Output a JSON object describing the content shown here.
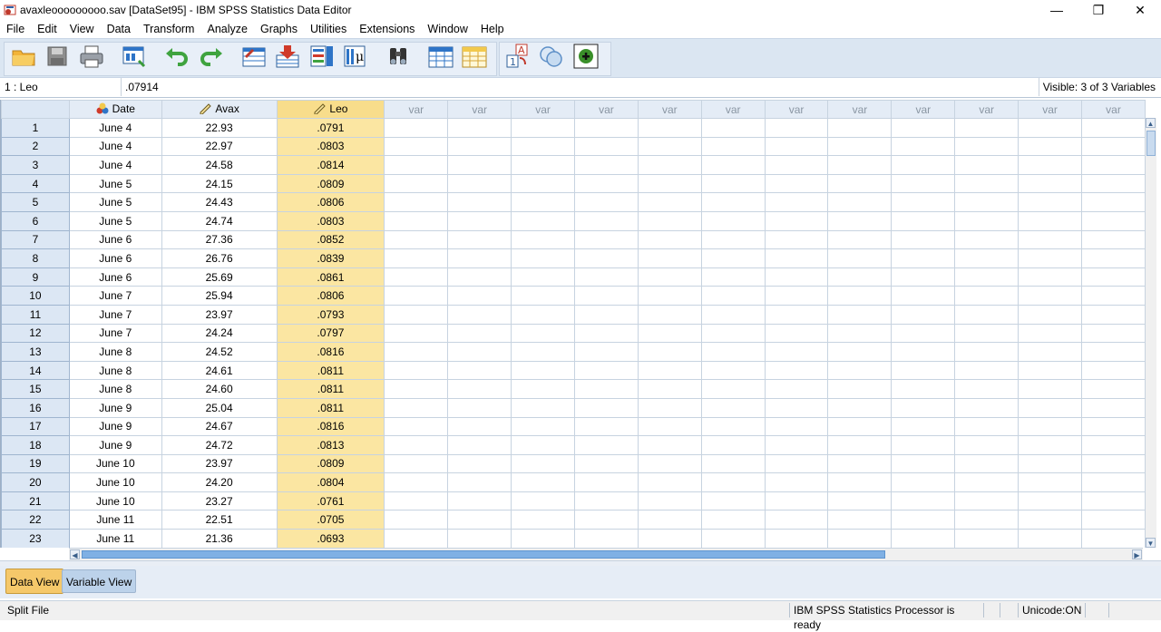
{
  "window": {
    "title": "avaxleooooooooo.sav [DataSet95] - IBM SPSS Statistics Data Editor",
    "minimize": "—",
    "restore": "❐",
    "close": "✕"
  },
  "menu": [
    "File",
    "Edit",
    "View",
    "Data",
    "Transform",
    "Analyze",
    "Graphs",
    "Utilities",
    "Extensions",
    "Window",
    "Help"
  ],
  "toolbar_icons": [
    "open-folder-icon",
    "save-icon",
    "print-icon",
    "recall-dialog-icon",
    "undo-icon",
    "redo-icon",
    "goto-case-icon",
    "goto-variable-icon",
    "variables-icon",
    "run-descriptives-icon",
    "find-icon",
    "insert-cases-icon",
    "insert-variable-icon",
    "value-labels-icon",
    "use-sets-icon",
    "show-all-icon"
  ],
  "cellbar": {
    "ref": "1 : Leo",
    "value": ".07914",
    "visible": "Visible: 3 of 3 Variables"
  },
  "grid": {
    "columns": [
      {
        "name": "Date",
        "icon": "nominal-icon"
      },
      {
        "name": "Avax",
        "icon": "scale-icon"
      },
      {
        "name": "Leo",
        "icon": "scale-icon"
      }
    ],
    "empty_column_label": "var",
    "rows": [
      [
        "1",
        "June 4",
        "22.93",
        ".0791"
      ],
      [
        "2",
        "June 4",
        "22.97",
        ".0803"
      ],
      [
        "3",
        "June 4",
        "24.58",
        ".0814"
      ],
      [
        "4",
        "June 5",
        "24.15",
        ".0809"
      ],
      [
        "5",
        "June 5",
        "24.43",
        ".0806"
      ],
      [
        "6",
        "June 5",
        "24.74",
        ".0803"
      ],
      [
        "7",
        "June 6",
        "27.36",
        ".0852"
      ],
      [
        "8",
        "June 6",
        "26.76",
        ".0839"
      ],
      [
        "9",
        "June 6",
        "25.69",
        ".0861"
      ],
      [
        "10",
        "June 7",
        "25.94",
        ".0806"
      ],
      [
        "11",
        "June 7",
        "23.97",
        ".0793"
      ],
      [
        "12",
        "June 7",
        "24.24",
        ".0797"
      ],
      [
        "13",
        "June 8",
        "24.52",
        ".0816"
      ],
      [
        "14",
        "June 8",
        "24.61",
        ".0811"
      ],
      [
        "15",
        "June 8",
        "24.60",
        ".0811"
      ],
      [
        "16",
        "June 9",
        "25.04",
        ".0811"
      ],
      [
        "17",
        "June 9",
        "24.67",
        ".0816"
      ],
      [
        "18",
        "June 9",
        "24.72",
        ".0813"
      ],
      [
        "19",
        "June 10",
        "23.97",
        ".0809"
      ],
      [
        "20",
        "June 10",
        "24.20",
        ".0804"
      ],
      [
        "21",
        "June 10",
        "23.27",
        ".0761"
      ],
      [
        "22",
        "June 11",
        "22.51",
        ".0705"
      ],
      [
        "23",
        "June 11",
        "21.36",
        ".0693"
      ]
    ]
  },
  "tabs": {
    "data_view": "Data View",
    "variable_view": "Variable View"
  },
  "status": {
    "split": "Split File",
    "processor": "IBM SPSS Statistics Processor is ready",
    "unicode": "Unicode:ON"
  },
  "colors": {
    "selected_column": "#fbe6a2",
    "toolbar_bg": "#dbe6f2",
    "active_tab": "#f5c86a"
  }
}
